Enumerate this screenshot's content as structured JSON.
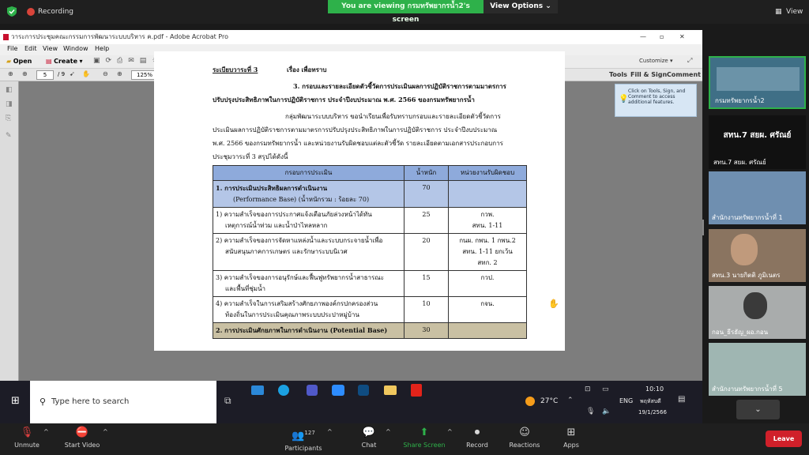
{
  "zoom_top": {
    "recording": "Recording",
    "viewing": "You are viewing กรมทรัพยากรน้ำ2's screen",
    "view_options": "View Options",
    "view": "View"
  },
  "acrobat": {
    "title": "วาระการประชุมคณะกรรมการพัฒนาระบบบริหาร ค.pdf - Adobe Acrobat Pro",
    "menu": [
      "File",
      "Edit",
      "View",
      "Window",
      "Help"
    ],
    "open": "Open",
    "create": "Create",
    "customize": "Customize",
    "page_current": "5",
    "page_total": "/ 9",
    "zoom": "125%",
    "tools": "Tools",
    "fill_sign": "Fill & Sign",
    "comment": "Comment",
    "tooltip": "Click on Tools, Sign, and Comment to access additional features."
  },
  "pdf": {
    "agenda": "ระเบียบวาระที่ 3",
    "subject": "เรื่อง เพื่อทราบ",
    "heading1": "3. กรอบและรายละเอียดตัวชี้วัดการประเมินผลการปฏิบัติราชการตามมาตรการ",
    "heading2": "ปรับปรุงประสิทธิภาพในการปฏิบัติราชการ ประจำปีงบประมาณ พ.ศ. 2566 ของกรมทรัพยากรน้ำ",
    "para": [
      "กลุ่มพัฒนาระบบบริหาร ขอนำเรียนเพื่อรับทราบกรอบและรายละเอียดตัวชี้วัดการ",
      "ประเมินผลการปฏิบัติราชการตามมาตรการปรับปรุงประสิทธิภาพในการปฏิบัติราชการ ประจำปีงบประมาณ",
      "พ.ศ. 2566 ของกรมทรัพยากรน้ำ และหน่วยงานรับผิดชอบแต่ละตัวชี้วัด รายละเอียดตามเอกสารประกอบการ",
      "ประชุมวาระที่ 3 สรุปได้ดังนี้"
    ],
    "table_header": [
      "กรอบการประเมิน",
      "น้ำหนัก",
      "หน่วยงานรับผิดชอบ"
    ],
    "section1": [
      "1. การประเมินประสิทธิผลการดำเนินงาน",
      "(Performance Base) (น้ำหนักรวม : ร้อยละ 70)"
    ],
    "section1_weight": "70",
    "rows": [
      {
        "num": "1)",
        "lines": [
          "ความสำเร็จของการประกาศแจ้งเตือนภัยล่วงหน้าได้ทัน",
          "เหตุการณ์น้ำท่วม และน้ำป่าไหลหลาก"
        ],
        "weight": "25",
        "unit": [
          "กวพ.",
          "สทน. 1-11"
        ]
      },
      {
        "num": "2)",
        "lines": [
          "ความสำเร็จของการจัดหาแหล่งน้ำและระบบกระจายน้ำเพื่อ",
          "สนับสนุนภาคการเกษตร และรักษาระบบนิเวศ"
        ],
        "weight": "20",
        "unit": [
          "กนผ. กพน. 1 กพน.2",
          "สทน. 1-11 ยกเว้น",
          "สทก. 2"
        ]
      },
      {
        "num": "3)",
        "lines": [
          "ความสำเร็จของการอนุรักษ์และฟื้นฟูทรัพยากรน้ำสาธารณะ",
          "และพื้นที่ชุ่มน้ำ"
        ],
        "weight": "15",
        "unit": [
          "กวป."
        ]
      },
      {
        "num": "4)",
        "lines": [
          "ความสำเร็จในการเสริมสร้างศักยภาพองค์กรปกครองส่วน",
          "ท้องถิ่นในการประเมินคุณภาพระบบประปาหมู่บ้าน"
        ],
        "weight": "10",
        "unit": [
          "กจน."
        ]
      }
    ],
    "section2": "2. การประเมินศักยภาพในการดำเนินงาน (Potential Base)",
    "section2_weight": "30"
  },
  "taskbar": {
    "search_placeholder": "Type here to search",
    "weather": "27°C",
    "lang": "ENG",
    "time": "10:10",
    "day": "พฤหัสบดี",
    "date": "19/1/2566"
  },
  "participants_panel": {
    "screen_share_name": "กรมทรัพยากรน้ำ2",
    "banner": "สทน.7 สยผ. ศรัณย์",
    "tiles": [
      "สทน.7 สยผ. ศรัณย์",
      "สำนักงานทรัพยากรน้ำที่ 1",
      "สทน.3 นายกิตติ ภูมิเนตร",
      "กอน_ธีรธัญ_ผอ.กอน",
      "สำนักงานทรัพยากรน้ำที่ 5"
    ]
  },
  "zoom_bottom": {
    "unmute": "Unmute",
    "start_video": "Start Video",
    "participants": "Participants",
    "participant_count": "127",
    "chat": "Chat",
    "share_screen": "Share Screen",
    "record": "Record",
    "reactions": "Reactions",
    "apps": "Apps",
    "leave": "Leave"
  },
  "colors": {
    "zoom_green": "#2eb14a",
    "leave_red": "#d0202a",
    "table_header_blue": "#8eaadb",
    "table_section_blue": "#b4c6e7"
  }
}
